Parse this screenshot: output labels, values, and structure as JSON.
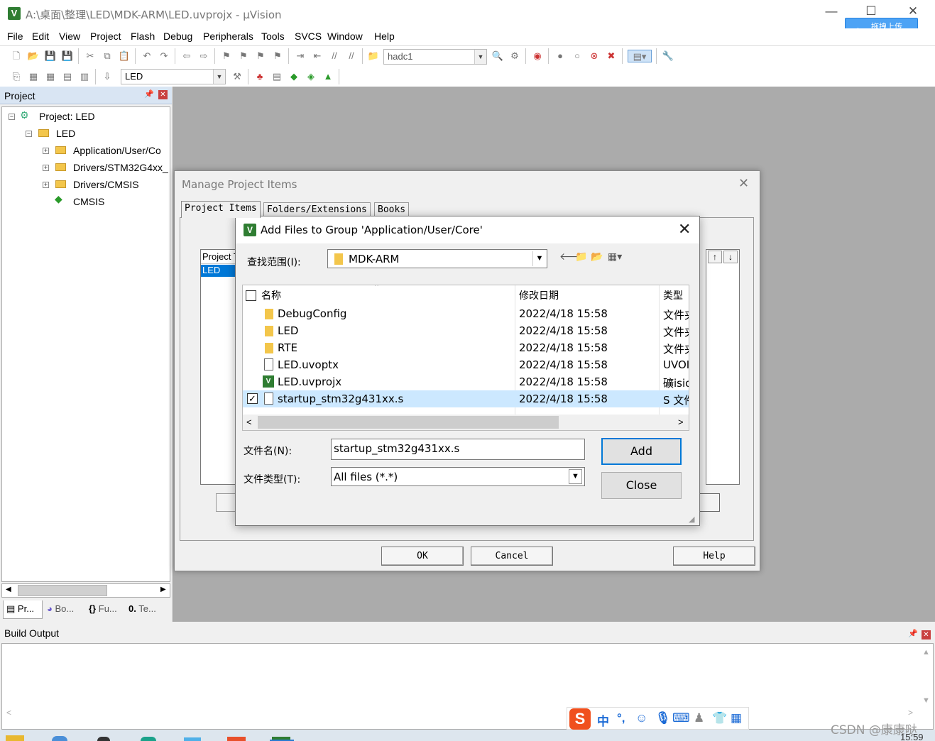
{
  "window": {
    "title": "A:\\桌面\\整理\\LED\\MDK-ARM\\LED.uvprojx - µVision",
    "icon": "keil-uvision-icon",
    "upload_button": "拖拽上传"
  },
  "menu": [
    "File",
    "Edit",
    "View",
    "Project",
    "Flash",
    "Debug",
    "Peripherals",
    "Tools",
    "SVCS",
    "Window",
    "Help"
  ],
  "toolbar": {
    "find_combo_value": "hadc1",
    "target_combo_value": "LED"
  },
  "project_panel": {
    "title": "Project",
    "tree": [
      {
        "label": "Project: LED",
        "level": 0
      },
      {
        "label": "LED",
        "level": 1
      },
      {
        "label": "Application/User/Co",
        "level": 2
      },
      {
        "label": "Drivers/STM32G4xx_",
        "level": 2
      },
      {
        "label": "Drivers/CMSIS",
        "level": 2
      },
      {
        "label": "CMSIS",
        "level": 2
      }
    ],
    "tabs": [
      "Pr...",
      "Bo...",
      "Fu...",
      "Te..."
    ]
  },
  "build_output": {
    "title": "Build Output"
  },
  "manage_dialog": {
    "title": "Manage Project Items",
    "tabs": [
      "Project Items",
      "Folders/Extensions",
      "Books"
    ],
    "list_header": "Project T",
    "selected_target": "LED",
    "buttons": [
      "OK",
      "Cancel",
      "Help"
    ]
  },
  "add_dialog": {
    "title": "Add Files to Group 'Application/User/Core'",
    "look_in_label": "查找范围(I):",
    "look_in_value": "MDK-ARM",
    "columns": [
      "名称",
      "修改日期",
      "类型"
    ],
    "files": [
      {
        "name": "DebugConfig",
        "date": "2022/4/18 15:58",
        "type": "文件夹",
        "kind": "folder",
        "selected": false
      },
      {
        "name": "LED",
        "date": "2022/4/18 15:58",
        "type": "文件夹",
        "kind": "folder",
        "selected": false
      },
      {
        "name": "RTE",
        "date": "2022/4/18 15:58",
        "type": "文件夹",
        "kind": "folder",
        "selected": false
      },
      {
        "name": "LED.uvoptx",
        "date": "2022/4/18 15:58",
        "type": "UVOI",
        "kind": "file",
        "selected": false
      },
      {
        "name": "LED.uvprojx",
        "date": "2022/4/18 15:58",
        "type": "礦isio",
        "kind": "uvision",
        "selected": false
      },
      {
        "name": "startup_stm32g431xx.s",
        "date": "2022/4/18 15:58",
        "type": "S 文件",
        "kind": "file",
        "selected": true
      }
    ],
    "filename_label": "文件名(N):",
    "filename_value": "startup_stm32g431xx.s",
    "filetype_label": "文件类型(T):",
    "filetype_value": "All files (*.*)",
    "add_button": "Add",
    "close_button": "Close"
  },
  "system": {
    "watermark": "CSDN @康康哒",
    "clock": "15:59",
    "ime_mode": "中"
  }
}
